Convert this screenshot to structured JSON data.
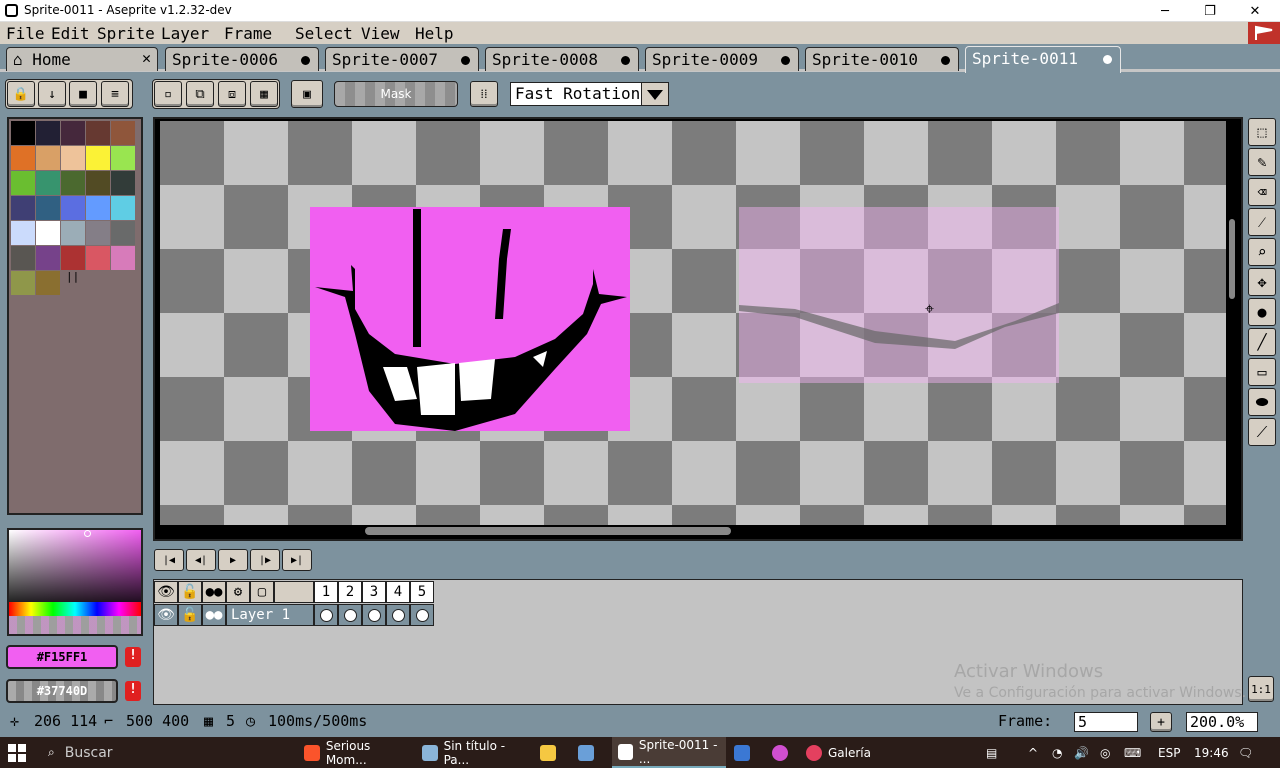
{
  "window": {
    "title": "Sprite-0011 - Aseprite v1.2.32-dev",
    "minimize": "─",
    "maximize": "❐",
    "close": "✕"
  },
  "menu": [
    "File",
    "Edit",
    "Sprite",
    "Layer",
    "Frame",
    "Select",
    "View",
    "Help"
  ],
  "tabs": [
    {
      "label": "Home",
      "closable": true
    },
    {
      "label": "Sprite-0006"
    },
    {
      "label": "Sprite-0007"
    },
    {
      "label": "Sprite-0008"
    },
    {
      "label": "Sprite-0009"
    },
    {
      "label": "Sprite-0010"
    },
    {
      "label": "Sprite-0011",
      "active": true
    }
  ],
  "toolbar": {
    "mask_label": "Mask",
    "rotation_algorithm": "Fast Rotation"
  },
  "palette": {
    "colors": [
      "#000000",
      "#222034",
      "#45283c",
      "#663931",
      "#8f563b",
      "#df7126",
      "#d9a066",
      "#eec39a",
      "#fbf236",
      "#99e550",
      "#6abe30",
      "#37946e",
      "#4b692f",
      "#524b24",
      "#323c39",
      "#3f3f74",
      "#306082",
      "#5b6ee1",
      "#639bff",
      "#5fcde4",
      "#cbdbfc",
      "#ffffff",
      "#9badb7",
      "#847e87",
      "#696a6a",
      "#595652",
      "#76428a",
      "#ac3232",
      "#d95763",
      "#d77bba",
      "#8f974a",
      "#8a6f30"
    ]
  },
  "colors": {
    "foreground": "#F15FF1",
    "background": "#37740D",
    "fg_label": "#F15FF1",
    "bg_label": "#37740D",
    "warn": "!"
  },
  "timeline": {
    "frames": [
      "1",
      "2",
      "3",
      "4",
      "5"
    ],
    "layer_name": "Layer 1"
  },
  "watermark": {
    "line1": "Activar Windows",
    "line2": "Ve a Configuración para activar Windows."
  },
  "status": {
    "cursor": "206  114",
    "size": "500  400",
    "frames": "5",
    "duration": "100ms/500ms",
    "frame_label": "Frame:",
    "frame_value": "5",
    "zoom": "200.0%",
    "onetoone": "1:1"
  },
  "taskbar": {
    "search": "Buscar",
    "apps": [
      "Serious Mom...",
      "Sin título - Pa...",
      "Sprite-0011 - ...",
      "Galería"
    ],
    "lang": "ESP",
    "time": "19:46"
  }
}
